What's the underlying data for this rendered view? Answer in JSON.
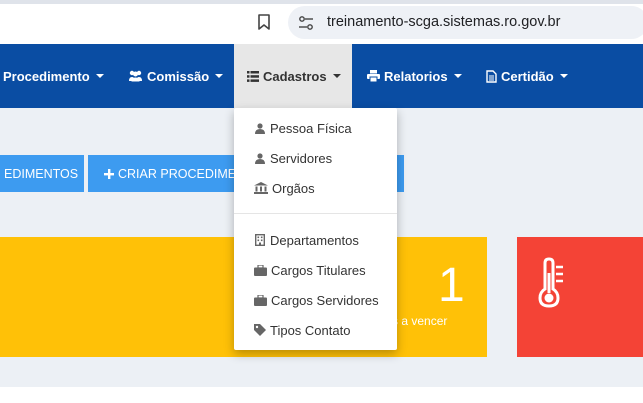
{
  "browser": {
    "url": "treinamento-scga.sistemas.ro.gov.br"
  },
  "nav": {
    "procedimento": "Procedimento",
    "comissao": "Comissão",
    "cadastros": "Cadastros",
    "relatorios": "Relatorios",
    "certidao": "Certidão"
  },
  "buttons": {
    "procedimentos": "EDIMENTOS",
    "criar": "CRIAR PROCEDIME"
  },
  "dashboard": {
    "count": "1",
    "count_label": "tes a vencer"
  },
  "dropdown": {
    "items": [
      "Pessoa Física",
      "Servidores",
      "Orgãos",
      "Departamentos",
      "Cargos Titulares",
      "Cargos Servidores",
      "Tipos Contato"
    ]
  },
  "colors": {
    "navbar": "#0a4da3",
    "button": "#3d9bf0",
    "warning": "#ffc107",
    "danger": "#f44336"
  }
}
